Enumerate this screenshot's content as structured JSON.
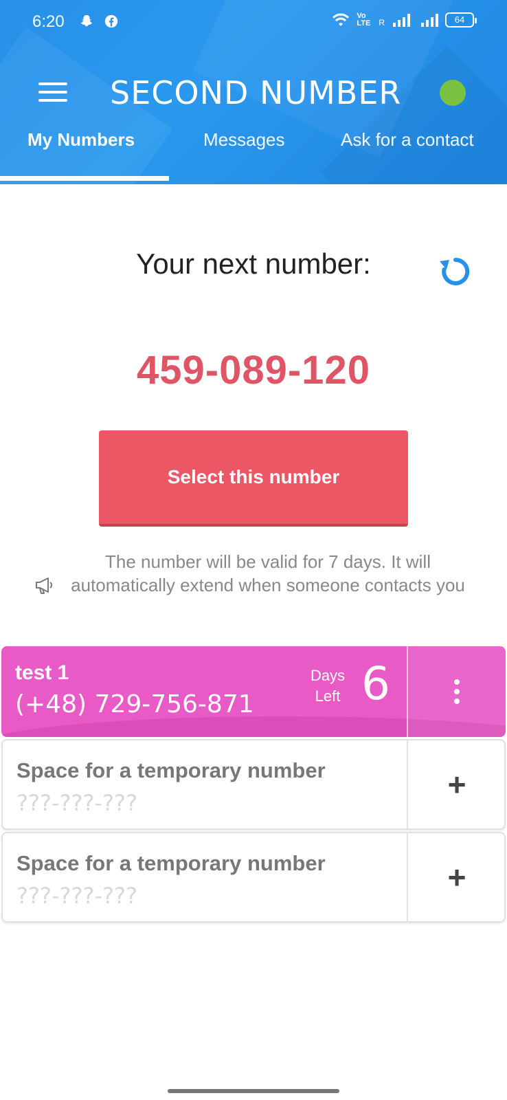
{
  "status_bar": {
    "time": "6:20",
    "battery": "64",
    "volte": "Vo LTE",
    "roaming": "R"
  },
  "app_bar": {
    "title": "SECOND NUMBER",
    "status_color": "#7cc242"
  },
  "tabs": [
    {
      "label": "My Numbers",
      "active": true
    },
    {
      "label": "Messages",
      "active": false
    },
    {
      "label": "Ask for a contact",
      "active": false
    }
  ],
  "next_number": {
    "heading": "Your next number:",
    "number": "459-089-120",
    "button_label": "Select this number",
    "info": "The number will be valid for 7 days. It will automatically extend when someone contacts you"
  },
  "numbers": [
    {
      "name": "test 1",
      "number": "(+48) 729-756-871",
      "days_label": "Days\nLeft",
      "days": "6"
    }
  ],
  "empty_slots": [
    {
      "label": "Space for a temporary number",
      "placeholder": "???-???-???"
    },
    {
      "label": "Space for a temporary number",
      "placeholder": "???-???-???"
    }
  ],
  "colors": {
    "header": "#2790e8",
    "accent": "#ec5766",
    "active_row": "#e85bc6"
  }
}
